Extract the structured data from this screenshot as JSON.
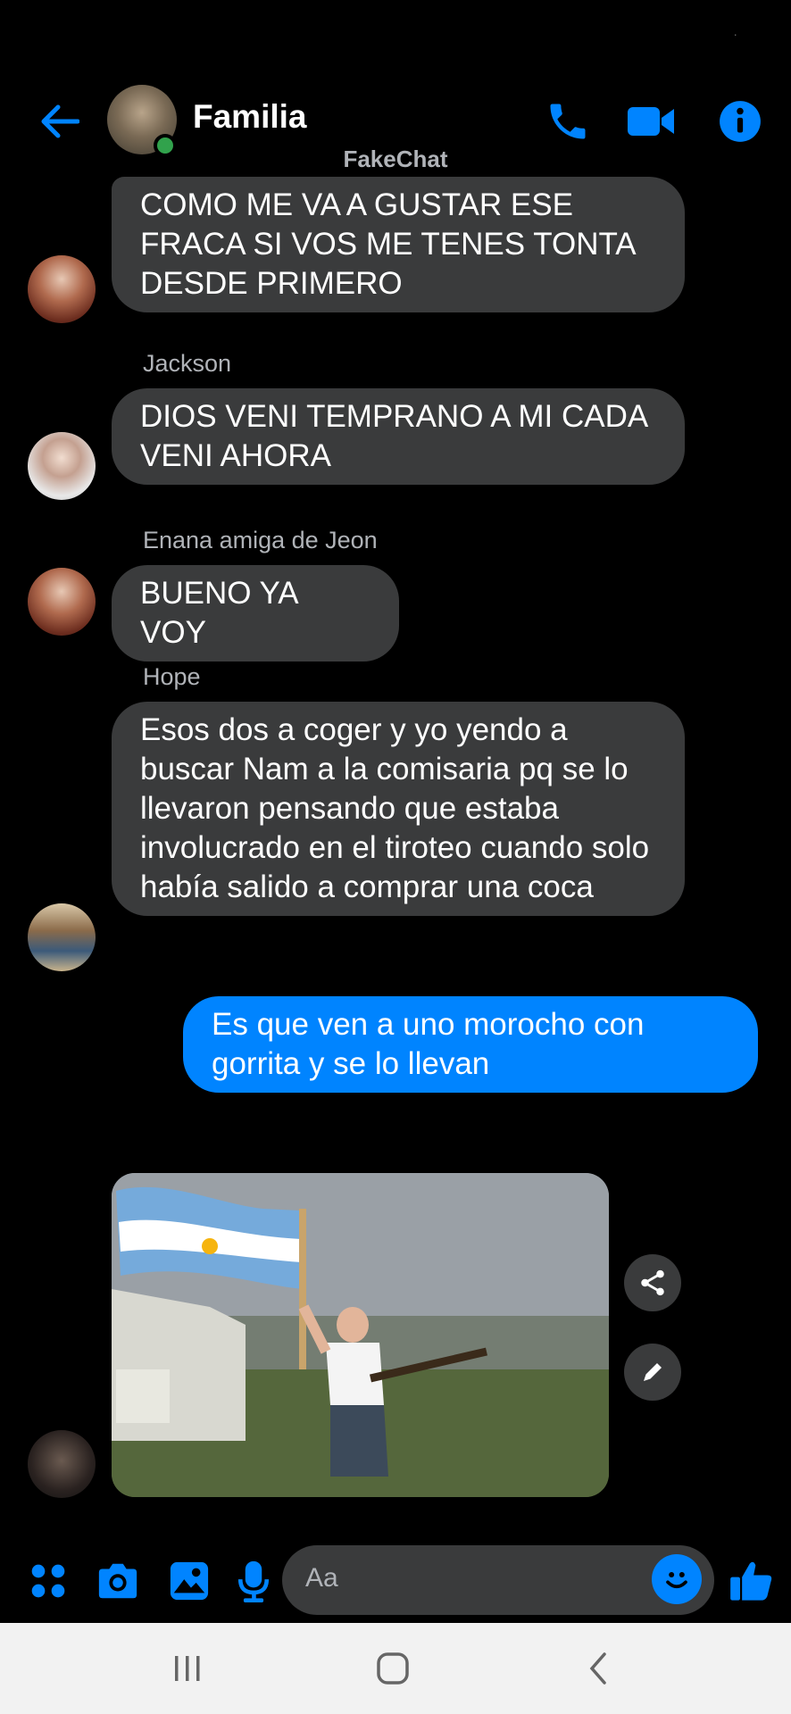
{
  "header": {
    "title": "Familia",
    "watermark": "FakeChat"
  },
  "messages": [
    {
      "sender": "",
      "text": "COMO ME VA A GUSTAR ESE FRACA SI VOS ME TENES TONTA DESDE PRIMERO"
    },
    {
      "sender": "Jackson",
      "text": "DIOS VENI TEMPRANO A MI CADA VENI AHORA"
    },
    {
      "sender": "Enana amiga de Jeon",
      "text": "BUENO YA VOY"
    },
    {
      "sender": "Hope",
      "text": "Esos dos a coger y yo yendo a buscar  Nam a la comisaria pq se lo llevaron pensando que estaba involucrado en el tiroteo cuando solo había salido a comprar una coca"
    },
    {
      "sender": "me",
      "text": "Es que ven a uno morocho con gorrita y se lo llevan"
    }
  ],
  "composer": {
    "placeholder": "Aa"
  },
  "colors": {
    "accent": "#0084ff",
    "bubble_other": "#3a3b3c",
    "online": "#31a24c"
  },
  "icons": [
    "back-arrow-icon",
    "phone-icon",
    "video-camera-icon",
    "info-icon",
    "menu-dots-icon",
    "camera-icon",
    "gallery-icon",
    "microphone-icon",
    "emoji-icon",
    "thumbs-up-icon",
    "share-icon",
    "edit-icon"
  ]
}
